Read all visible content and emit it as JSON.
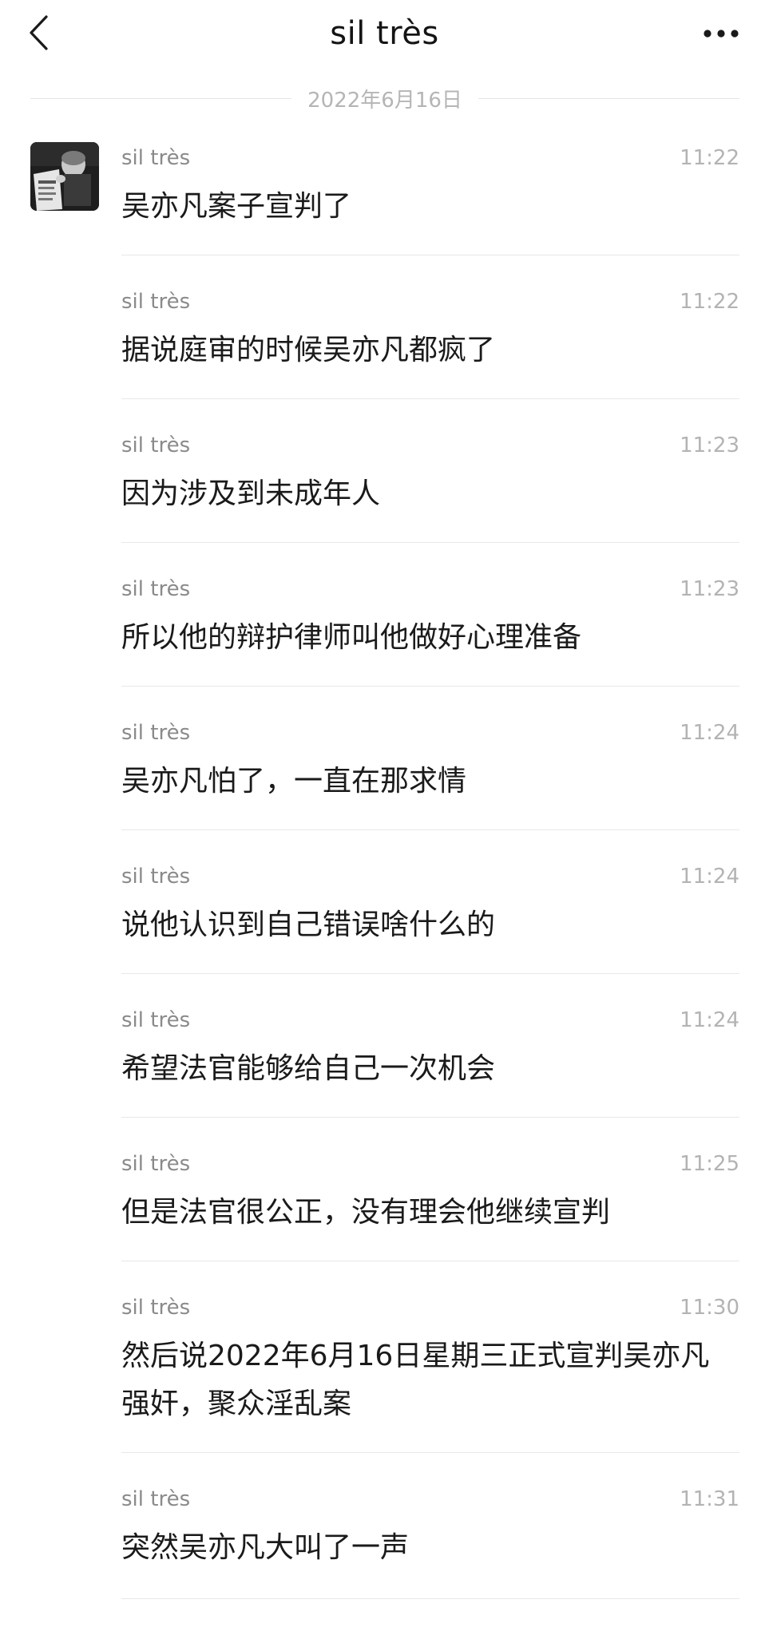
{
  "header": {
    "title": "sil très",
    "back_icon": "chevron-left-icon",
    "more_icon": "more-horizontal-icon"
  },
  "date_divider": "2022年6月16日",
  "messages": [
    {
      "sender": "sil très",
      "time": "11:22",
      "text": "吴亦凡案子宣判了"
    },
    {
      "sender": "sil très",
      "time": "11:22",
      "text": "据说庭审的时候吴亦凡都疯了"
    },
    {
      "sender": "sil très",
      "time": "11:23",
      "text": "因为涉及到未成年人"
    },
    {
      "sender": "sil très",
      "time": "11:23",
      "text": "所以他的辩护律师叫他做好心理准备"
    },
    {
      "sender": "sil très",
      "time": "11:24",
      "text": "吴亦凡怕了，一直在那求情"
    },
    {
      "sender": "sil très",
      "time": "11:24",
      "text": "说他认识到自己错误啥什么的"
    },
    {
      "sender": "sil très",
      "time": "11:24",
      "text": "希望法官能够给自己一次机会"
    },
    {
      "sender": "sil très",
      "time": "11:25",
      "text": "但是法官很公正，没有理会他继续宣判"
    },
    {
      "sender": "sil très",
      "time": "11:30",
      "text": "然后说2022年6月16日星期三正式宣判吴亦凡强奸，聚众淫乱案"
    },
    {
      "sender": "sil très",
      "time": "11:31",
      "text": "突然吴亦凡大叫了一声"
    }
  ]
}
